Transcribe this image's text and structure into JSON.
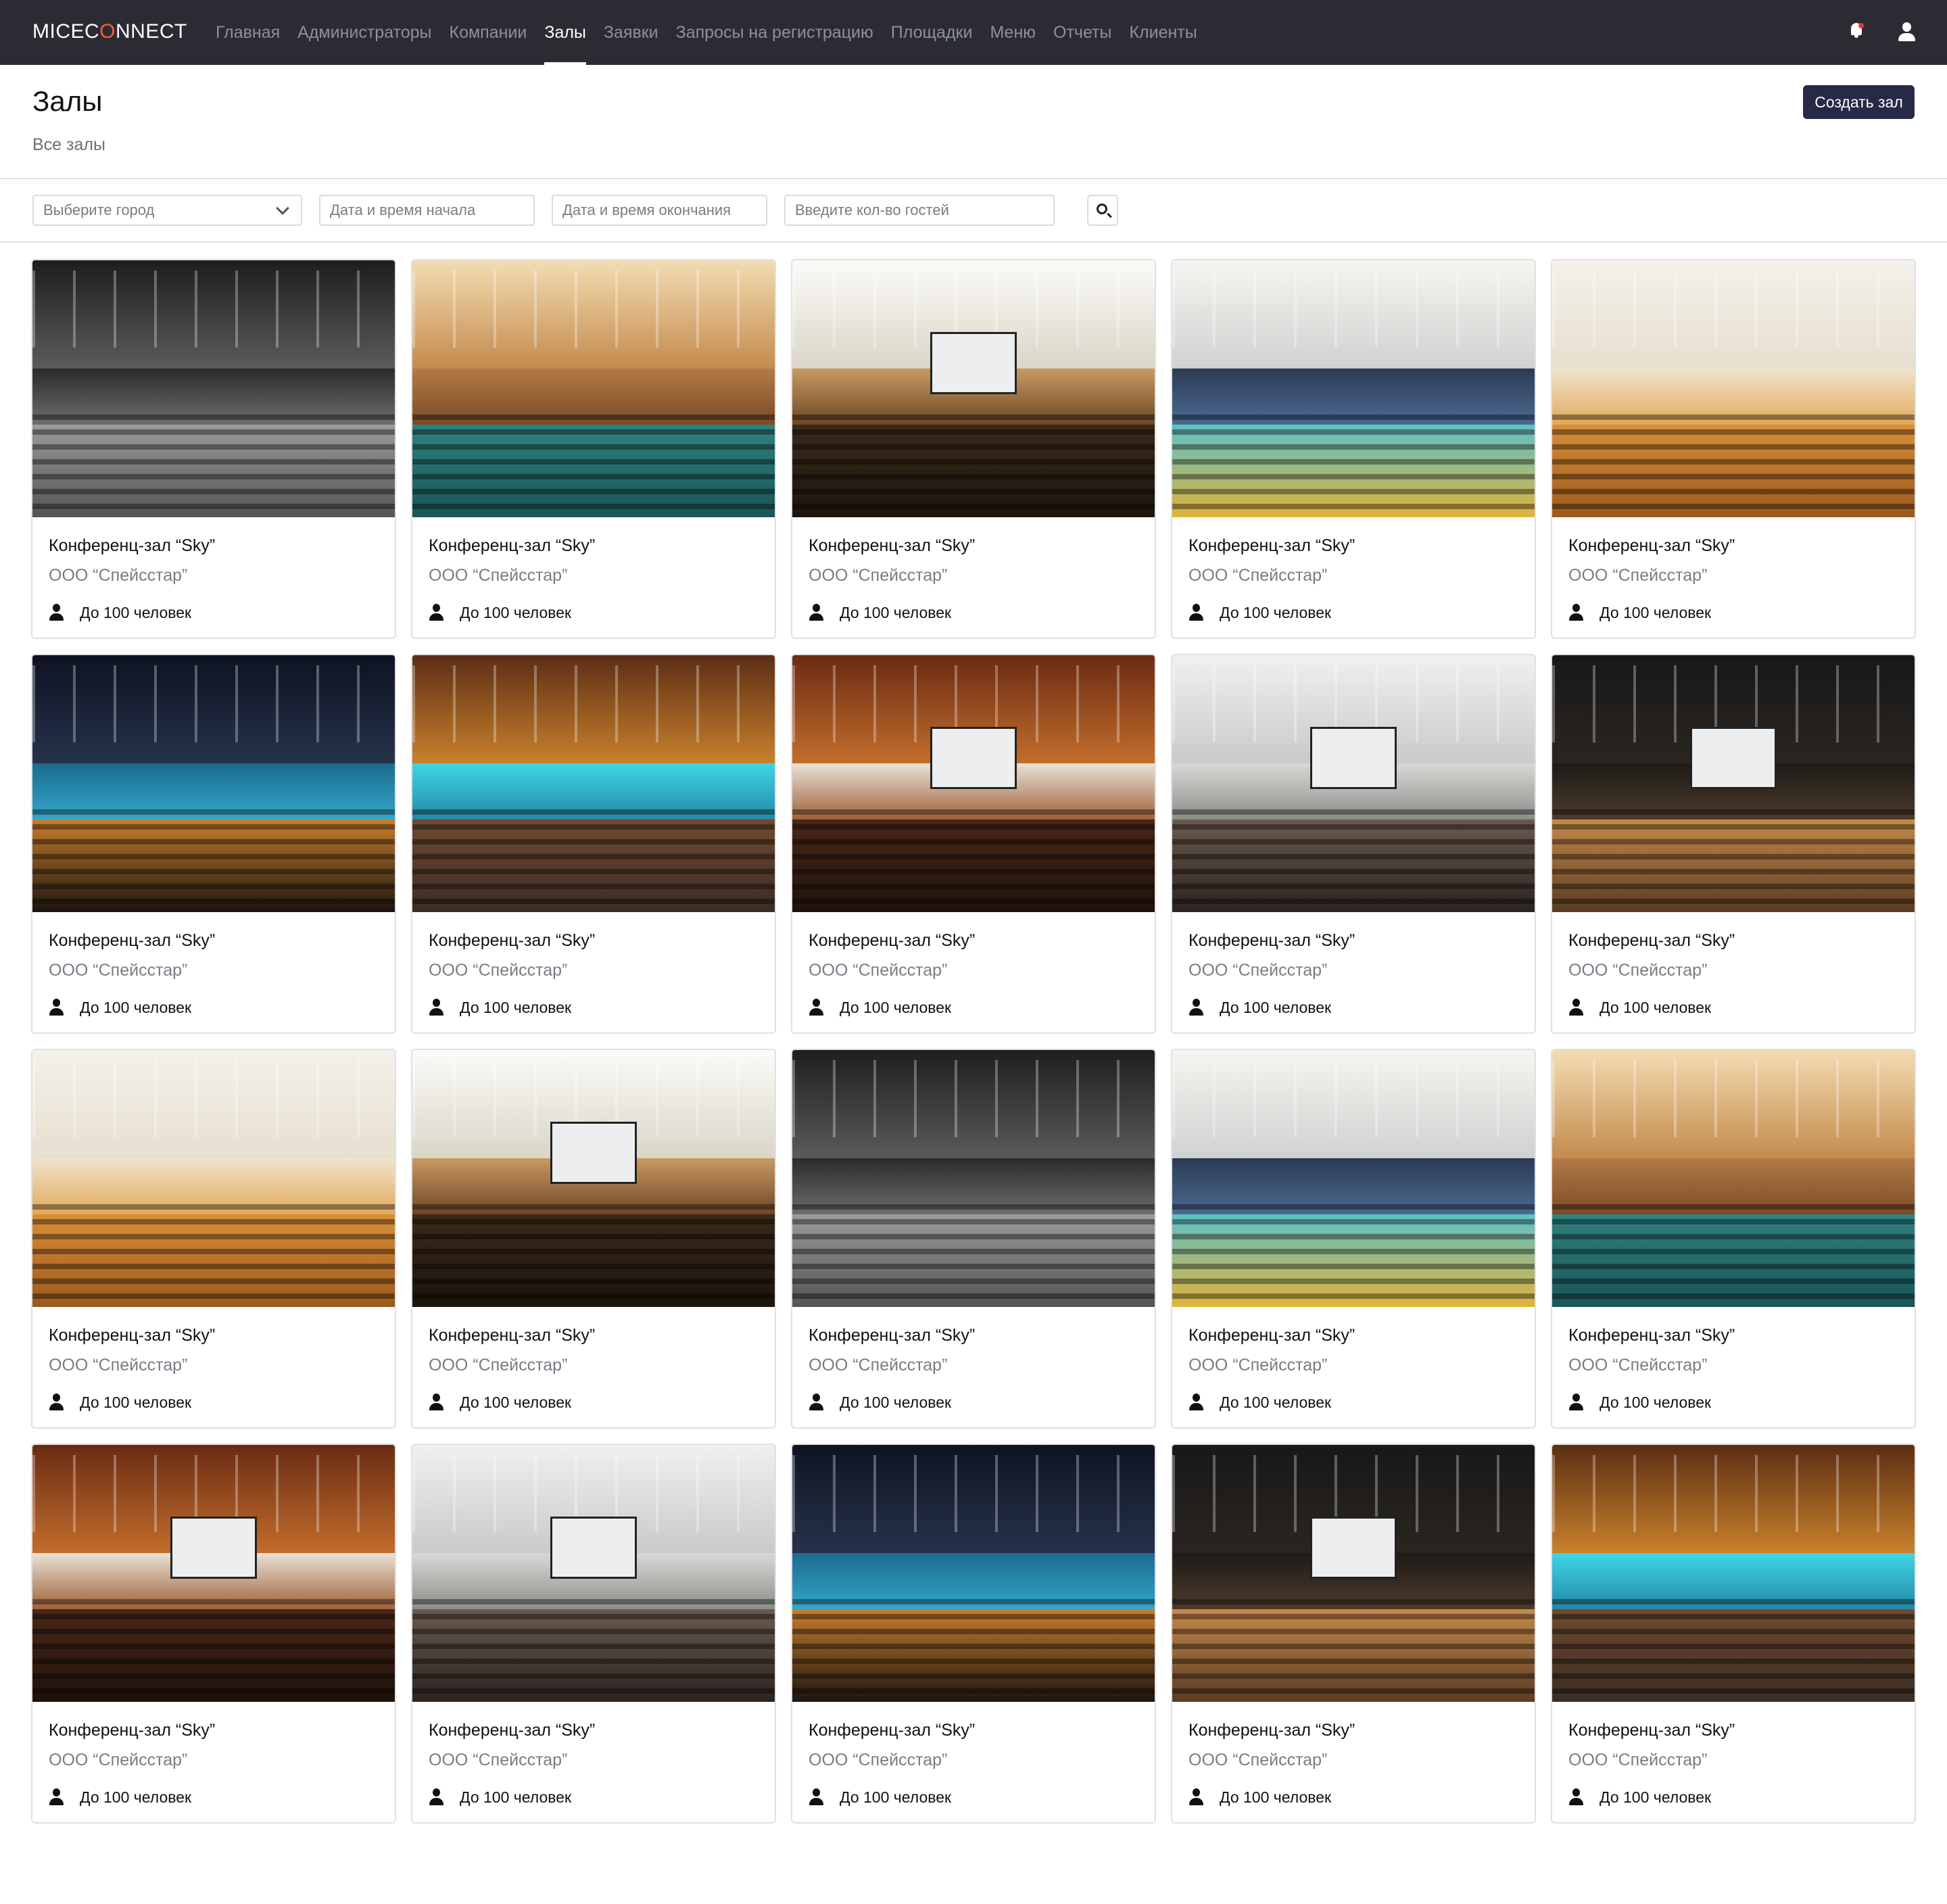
{
  "app": {
    "logo_prefix": "MICEC",
    "logo_o": "O",
    "logo_suffix": "NNECT"
  },
  "nav": {
    "items": [
      {
        "label": "Главная",
        "active": false
      },
      {
        "label": "Администраторы",
        "active": false
      },
      {
        "label": "Компании",
        "active": false
      },
      {
        "label": "Залы",
        "active": true
      },
      {
        "label": "Заявки",
        "active": false
      },
      {
        "label": "Запросы на регистрацию",
        "active": false
      },
      {
        "label": "Площадки",
        "active": false
      },
      {
        "label": "Меню",
        "active": false
      },
      {
        "label": "Отчеты",
        "active": false
      },
      {
        "label": "Клиенты",
        "active": false
      }
    ],
    "icons": [
      "bell-icon",
      "user-icon"
    ]
  },
  "header": {
    "title": "Залы",
    "subtitle": "Все залы",
    "create_button": "Создать зал"
  },
  "filters": {
    "city_placeholder": "Выберите город",
    "start_placeholder": "Дата и время начала",
    "end_placeholder": "Дата и время окончания",
    "guests_placeholder": "Введите кол-во гостей",
    "search_icon": "search-icon"
  },
  "colors": {
    "topbar": "#2b2c33",
    "primary_button": "#262a47",
    "logo_accent": "#ff5a3c",
    "notification_dot": "#e53935"
  },
  "halls": [
    {
      "title": "Конференц-зал “Sky”",
      "company": "ООО “Спейсстар”",
      "capacity": "До 100 человек",
      "photo": "bw"
    },
    {
      "title": "Конференц-зал “Sky”",
      "company": "ООО “Спейсстар”",
      "capacity": "До 100 человек",
      "photo": "teal"
    },
    {
      "title": "Конференц-зал “Sky”",
      "company": "ООО “Спейсстар”",
      "capacity": "До 100 человек",
      "photo": "proj"
    },
    {
      "title": "Конференц-зал “Sky”",
      "company": "ООО “Спейсстар”",
      "capacity": "До 100 человек",
      "photo": "blue"
    },
    {
      "title": "Конференц-зал “Sky”",
      "company": "ООО “Спейсстар”",
      "capacity": "До 100 человек",
      "photo": "gold"
    },
    {
      "title": "Конференц-зал “Sky”",
      "company": "ООО “Спейсстар”",
      "capacity": "До 100 человек",
      "photo": "stage"
    },
    {
      "title": "Конференц-зал “Sky”",
      "company": "ООО “Спейсстар”",
      "capacity": "До 100 человек",
      "photo": "cyan"
    },
    {
      "title": "Конференц-зал “Sky”",
      "company": "ООО “Спейсстар”",
      "capacity": "До 100 человек",
      "photo": "crowd"
    },
    {
      "title": "Конференц-зал “Sky”",
      "company": "ООО “Спейсстар”",
      "capacity": "До 100 человек",
      "photo": "gray"
    },
    {
      "title": "Конференц-зал “Sky”",
      "company": "ООО “Спейсстар”",
      "capacity": "До 100 человек",
      "photo": "dark"
    },
    {
      "title": "Конференц-зал “Sky”",
      "company": "ООО “Спейсстар”",
      "capacity": "До 100 человек",
      "photo": "gold"
    },
    {
      "title": "Конференц-зал “Sky”",
      "company": "ООО “Спейсстар”",
      "capacity": "До 100 человек",
      "photo": "proj"
    },
    {
      "title": "Конференц-зал “Sky”",
      "company": "ООО “Спейсстар”",
      "capacity": "До 100 человек",
      "photo": "bw"
    },
    {
      "title": "Конференц-зал “Sky”",
      "company": "ООО “Спейсстар”",
      "capacity": "До 100 человек",
      "photo": "blue"
    },
    {
      "title": "Конференц-зал “Sky”",
      "company": "ООО “Спейсстар”",
      "capacity": "До 100 человек",
      "photo": "teal"
    },
    {
      "title": "Конференц-зал “Sky”",
      "company": "ООО “Спейсстар”",
      "capacity": "До 100 человек",
      "photo": "crowd"
    },
    {
      "title": "Конференц-зал “Sky”",
      "company": "ООО “Спейсстар”",
      "capacity": "До 100 человек",
      "photo": "gray"
    },
    {
      "title": "Конференц-зал “Sky”",
      "company": "ООО “Спейсстар”",
      "capacity": "До 100 человек",
      "photo": "stage"
    },
    {
      "title": "Конференц-зал “Sky”",
      "company": "ООО “Спейсстар”",
      "capacity": "До 100 человек",
      "photo": "dark"
    },
    {
      "title": "Конференц-зал “Sky”",
      "company": "ООО “Спейсстар”",
      "capacity": "До 100 человек",
      "photo": "cyan"
    }
  ]
}
